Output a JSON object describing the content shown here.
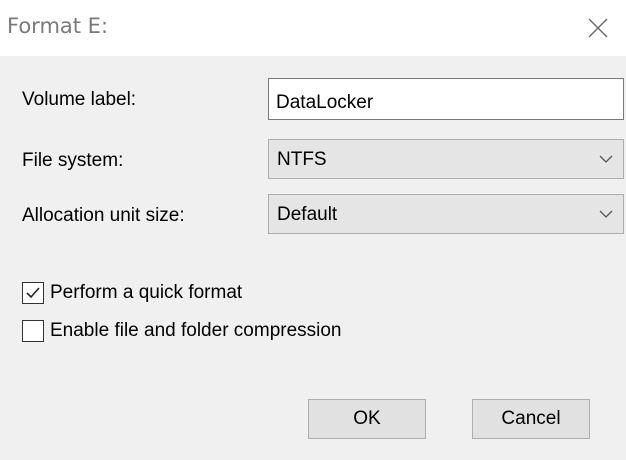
{
  "window": {
    "title": "Format E:",
    "close_icon": "close-icon"
  },
  "form": {
    "volume_label": {
      "label": "Volume label:",
      "value": "DataLocker"
    },
    "file_system": {
      "label": "File system:",
      "selected": "NTFS"
    },
    "allocation_unit_size": {
      "label": "Allocation unit size:",
      "selected": "Default"
    }
  },
  "options": {
    "quick_format": {
      "label": "Perform a quick format",
      "checked": true
    },
    "compression": {
      "label": "Enable file and folder compression",
      "checked": false
    }
  },
  "buttons": {
    "ok": "OK",
    "cancel": "Cancel"
  },
  "colors": {
    "window_bg": "#f0f0f0",
    "titlebar_bg": "#ffffff",
    "title_text": "#7a7a7a",
    "combo_bg": "#e5e5e5",
    "button_bg": "#e1e1e1"
  }
}
